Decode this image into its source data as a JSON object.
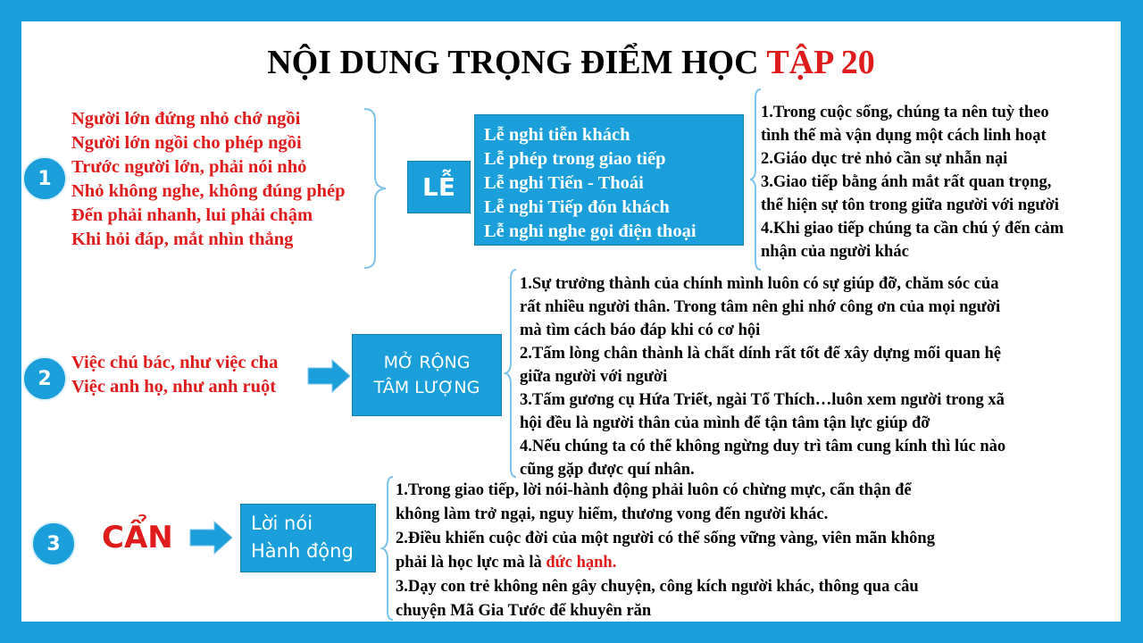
{
  "title": {
    "main": "NỘI DUNG TRỌNG ĐIỂM HỌC ",
    "highlight": "TẬP 20"
  },
  "section1": {
    "number": "1",
    "rules": [
      "Người lớn đứng nhỏ chớ ngồi",
      "Người lớn ngồi cho phép ngồi",
      "Trước người lớn, phải nói nhỏ",
      "Nhỏ không nghe, không đúng phép",
      "Đến phải nhanh, lui phải chậm",
      "Khi hỏi đáp, mắt nhìn thẳng"
    ],
    "topic": "LỄ",
    "items": [
      "Lễ nghi tiễn khách",
      "Lễ phép trong giao tiếp",
      "Lễ nghi Tiến - Thoái",
      "Lễ nghi Tiếp đón khách",
      "Lễ nghi nghe gọi điện thoại"
    ],
    "notes": [
      "1.Trong cuộc sống, chúng ta nên tuỳ theo",
      "tình thế mà vận dụng một cách linh hoạt",
      "2.Giáo dục trẻ nhỏ cần sự nhẫn nại",
      "3.Giao tiếp bằng ánh mắt rất quan trọng,",
      "thể hiện sự tôn trong giữa người với người",
      "4.Khi giao tiếp chúng ta cần chú ý đến cảm",
      "nhận của người khác"
    ]
  },
  "section2": {
    "number": "2",
    "rules": [
      "Việc chú bác, như việc cha",
      "Việc anh họ, như anh ruột"
    ],
    "topic_line1": "MỞ RỘNG",
    "topic_line2": "TÂM LƯỢNG",
    "notes": [
      "1.Sự trưởng thành của chính mình luôn có sự giúp đỡ, chăm sóc của",
      "rất nhiều người thân. Trong tâm nên ghi nhớ công ơn của mọi người",
      "mà tìm cách báo đáp khi có cơ hội",
      "2.Tấm lòng chân thành là chất dính rất tốt để xây dựng mối quan hệ",
      "giữa người với người",
      "3.Tấm gương cụ Hứa Triết, ngài Tổ Thích…luôn xem người trong xã",
      "hội đều là người thân của mình để tận tâm tận lực giúp đỡ",
      "4.Nếu chúng ta có thể không ngừng duy trì tâm cung kính thì lúc nào",
      "cũng gặp được quí nhân."
    ]
  },
  "section3": {
    "number": "3",
    "keyword": "CẨN",
    "topic_line1": "Lời nói",
    "topic_line2": "Hành động",
    "notes": [
      "1.Trong giao tiếp, lời nói-hành động phải luôn có chừng mực, cẩn thận để",
      "không làm trở ngại, nguy hiểm, thương vong đến người khác.",
      "2.Điều khiển cuộc đời của một người có thể sống vững vàng, viên mãn không"
    ],
    "note_line4_prefix": "phải là học lực mà là ",
    "note_line4_highlight": "đức hạnh.",
    "notes_tail": [
      "3.Dạy con trẻ không nên gây chuyện, công kích người khác, thông qua câu",
      "chuyện Mã Gia Tước để khuyên răn"
    ]
  },
  "colors": {
    "accent_blue": "#1a9fdb",
    "highlight_red": "#e01b1b"
  },
  "icons": {
    "arrow": "right-arrow-icon",
    "bracket": "curly-bracket-icon"
  }
}
